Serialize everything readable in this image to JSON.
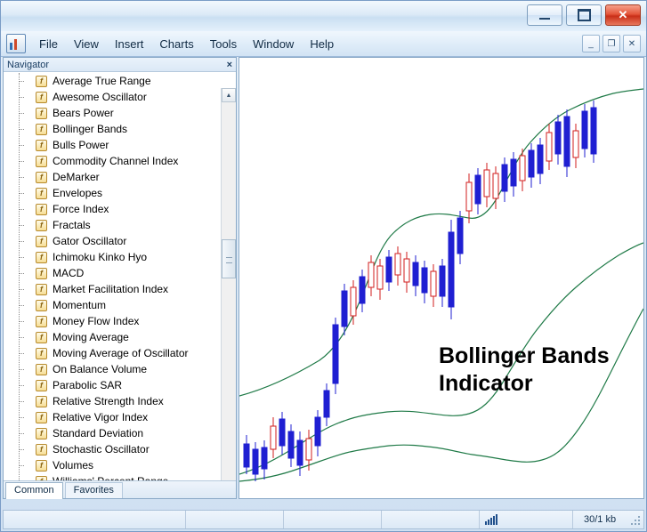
{
  "window": {
    "title": "",
    "buttons": {
      "minimize": "minimize-icon",
      "maximize": "maximize-icon",
      "close": "✕"
    }
  },
  "menubar": {
    "app_icon": "metatrader-icon",
    "items": [
      "File",
      "View",
      "Insert",
      "Charts",
      "Tools",
      "Window",
      "Help"
    ],
    "mdi_buttons": [
      "_",
      "❐",
      "✕"
    ]
  },
  "navigator": {
    "title": "Navigator",
    "close_label": "×",
    "items": [
      "Average True Range",
      "Awesome Oscillator",
      "Bears Power",
      "Bollinger Bands",
      "Bulls Power",
      "Commodity Channel Index",
      "DeMarker",
      "Envelopes",
      "Force Index",
      "Fractals",
      "Gator Oscillator",
      "Ichimoku Kinko Hyo",
      "MACD",
      "Market Facilitation Index",
      "Momentum",
      "Money Flow Index",
      "Moving Average",
      "Moving Average of Oscillator",
      "On Balance Volume",
      "Parabolic SAR",
      "Relative Strength Index",
      "Relative Vigor Index",
      "Standard Deviation",
      "Stochastic Oscillator",
      "Volumes",
      "Williams' Percent Range"
    ],
    "item_icon": "f",
    "tabs": [
      {
        "label": "Common",
        "active": true
      },
      {
        "label": "Favorites",
        "active": false
      }
    ],
    "scroll_up": "▲",
    "scroll_down": "▼"
  },
  "chart": {
    "caption_line1": "Bollinger Bands",
    "caption_line2": "Indicator",
    "colors": {
      "bull_candle": "#d21d1d",
      "bear_candle": "#1f1fd2",
      "band_line": "#1f7a47",
      "background": "#ffffff"
    }
  },
  "statusbar": {
    "text_left": "",
    "traffic_icon": "signal-bars-icon",
    "transfer": "30/1 kb"
  }
}
